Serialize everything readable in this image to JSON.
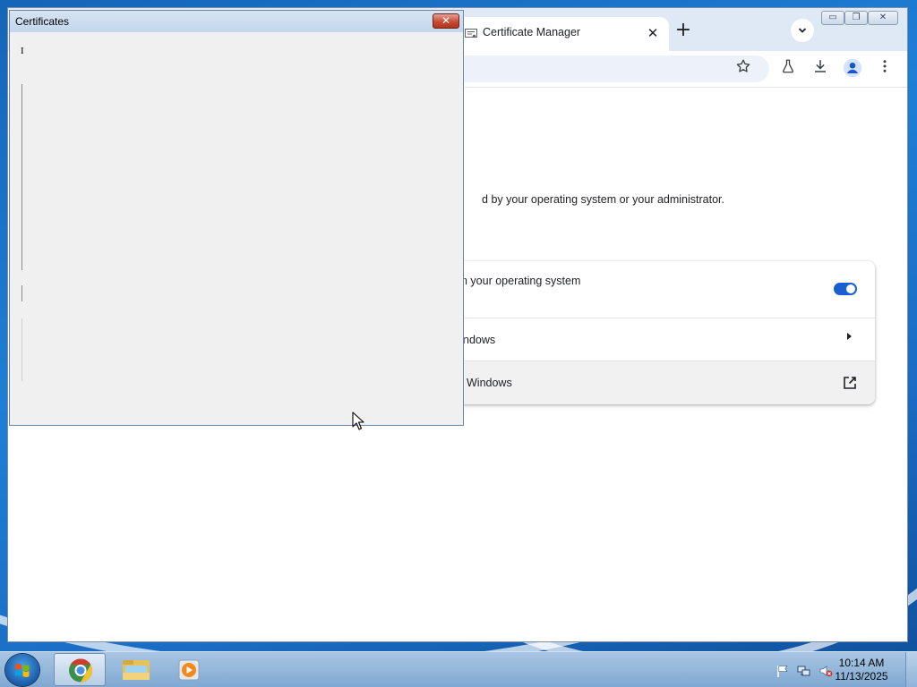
{
  "desktop": {
    "accent": "#1e7fd6"
  },
  "browser": {
    "tab": {
      "title": "Certificate Manager",
      "favicon": "certificate-icon",
      "close_glyph": "✕"
    },
    "new_tab_glyph": "+",
    "tab_search_glyph": "⌄",
    "window_controls": {
      "minimize": "▭",
      "restore": "❐",
      "close": "✕"
    },
    "toolbar_icons": [
      "star-icon",
      "labs-flask-icon",
      "download-icon",
      "profile-icon",
      "more-vert-icon"
    ],
    "content": {
      "description": "d by your operating system or your administrator.",
      "rows": {
        "use_os": {
          "label": "n your operating system",
          "toggle_on": true
        },
        "manage": {
          "label": "ndows"
        },
        "learn": {
          "label": "Windows"
        }
      }
    }
  },
  "cert_dialog": {
    "title": "Certificates",
    "close_glyph": "✕",
    "label": "I"
  },
  "taskbar": {
    "time": "10:14 AM",
    "date": "11/13/2025",
    "apps": [
      "chrome-icon",
      "explorer-icon",
      "media-player-icon"
    ],
    "tray_icons": [
      "flag-icon",
      "network-icon",
      "volume-muted-icon"
    ]
  }
}
